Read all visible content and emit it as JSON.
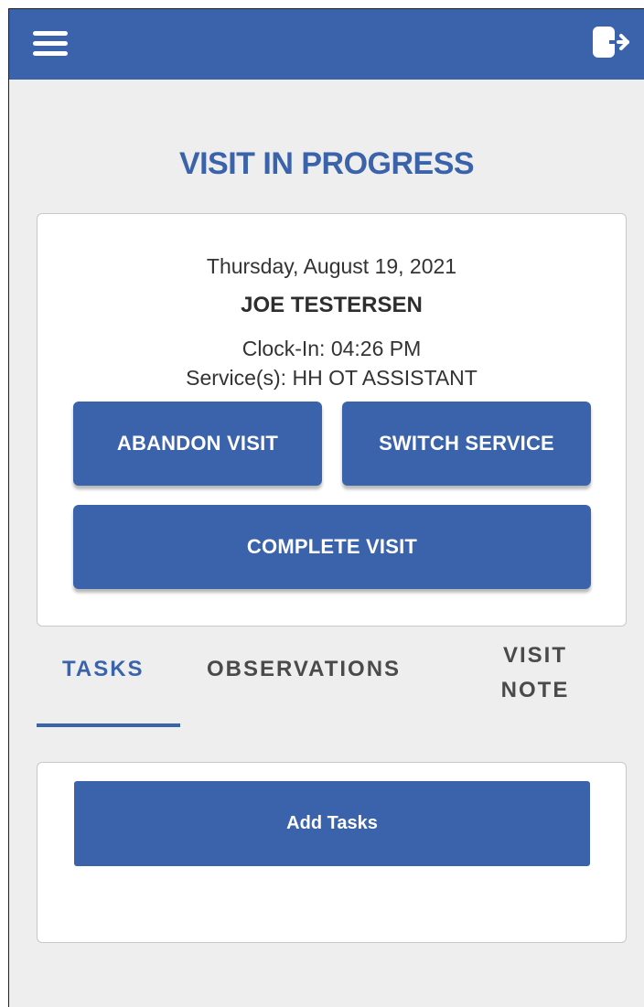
{
  "header": {
    "menu_icon": "hamburger-menu-icon",
    "logout_icon": "logout-icon",
    "accent_color": "#3a63ab"
  },
  "page": {
    "title": "VISIT IN PROGRESS"
  },
  "visit": {
    "date": "Thursday, August 19, 2021",
    "patient_name": "JOE TESTERSEN",
    "clock_in": "Clock-In: 04:26 PM",
    "services": "Service(s): HH OT ASSISTANT"
  },
  "actions": {
    "abandon_label": "ABANDON VISIT",
    "switch_label": "SWITCH SERVICE",
    "complete_label": "COMPLETE VISIT"
  },
  "tabs": [
    {
      "label": "TASKS",
      "active": true
    },
    {
      "label": "OBSERVATIONS",
      "active": false
    },
    {
      "label": "VISIT NOTE",
      "line1": "VISIT",
      "line2": "NOTE",
      "active": false
    }
  ],
  "tasks": {
    "add_label": "Add Tasks"
  }
}
